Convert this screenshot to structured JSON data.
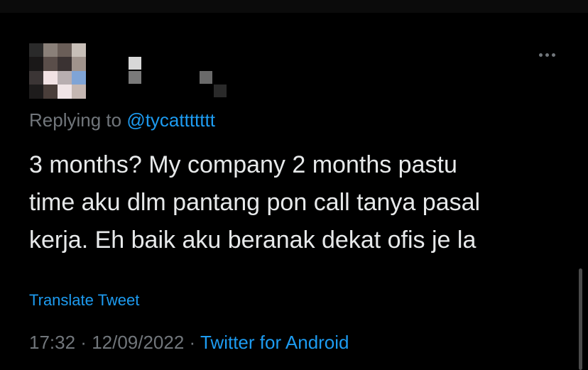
{
  "tweet": {
    "replying_prefix": "Replying to ",
    "replying_handle": "@tycattttttt",
    "body_lines": [
      "3 months? My company 2 months pastu",
      "time aku dlm pantang pon call tanya pasal",
      "kerja. Eh baik aku beranak dekat ofis je la"
    ],
    "translate_label": "Translate Tweet",
    "time": "17:32",
    "separator": " · ",
    "date": "12/09/2022",
    "source": "Twitter for Android"
  },
  "icons": {
    "more": "more-horizontal-icon"
  },
  "colors": {
    "background": "#000000",
    "text_primary": "#e7e9ea",
    "text_secondary": "#71767b",
    "accent": "#1d9bf0"
  }
}
